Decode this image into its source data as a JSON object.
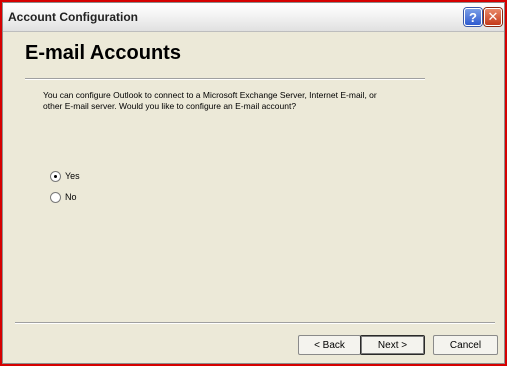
{
  "window": {
    "title": "Account Configuration",
    "help_glyph": "?",
    "close_glyph": "✕"
  },
  "header": {
    "title": "E-mail Accounts"
  },
  "content": {
    "description": "You can configure Outlook to connect to a Microsoft Exchange Server, Internet E-mail, or other E-mail server.  Would you like to configure an E-mail account?",
    "options": [
      {
        "label": "Yes",
        "selected": true
      },
      {
        "label": "No",
        "selected": false
      }
    ]
  },
  "footer": {
    "back_label": "< Back",
    "next_label": "Next >",
    "cancel_label": "Cancel"
  },
  "colors": {
    "frame": "#d60000",
    "dialog_bg": "#ece9d8"
  }
}
